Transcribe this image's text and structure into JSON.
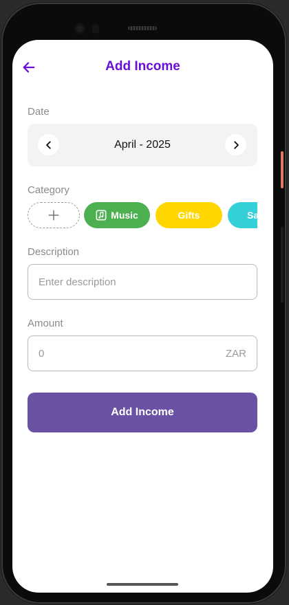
{
  "header": {
    "title": "Add Income",
    "back_icon": "arrow-left-icon",
    "accent_color": "#6a0dd6"
  },
  "date": {
    "label": "Date",
    "value": "April - 2025",
    "prev_icon": "chevron-left-icon",
    "next_icon": "chevron-right-icon"
  },
  "category": {
    "label": "Category",
    "add_icon": "plus-icon",
    "chips": [
      {
        "label": "Music",
        "icon": "music-note-icon",
        "color": "#4caf50"
      },
      {
        "label": "Gifts",
        "color": "#ffd600"
      },
      {
        "label": "Sa",
        "color": "#35cfd8"
      }
    ]
  },
  "description": {
    "label": "Description",
    "placeholder": "Enter description",
    "value": ""
  },
  "amount": {
    "label": "Amount",
    "placeholder": "0",
    "currency": "ZAR"
  },
  "submit": {
    "label": "Add Income",
    "color": "#6a51a4"
  }
}
